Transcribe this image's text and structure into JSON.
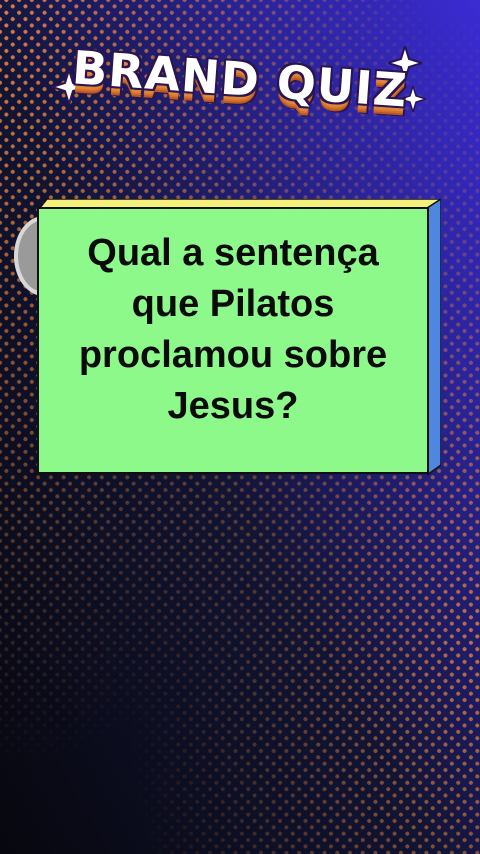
{
  "header": {
    "title": "BRAND QUIZ"
  },
  "question_card": {
    "question": "Qual a sentença que Pilatos proclamou sobre Jesus?",
    "background_color": "#8cf98a",
    "top_edge_color": "#f5f07a",
    "side_edge_color": "#4e86e0"
  },
  "theme": {
    "background_dark": "#0a0c1a",
    "background_blue": "#3527c8",
    "dot_color": "#f08a3a"
  },
  "icons": {
    "sparkle": "four-point-star",
    "avatar": "circle-avatar"
  }
}
